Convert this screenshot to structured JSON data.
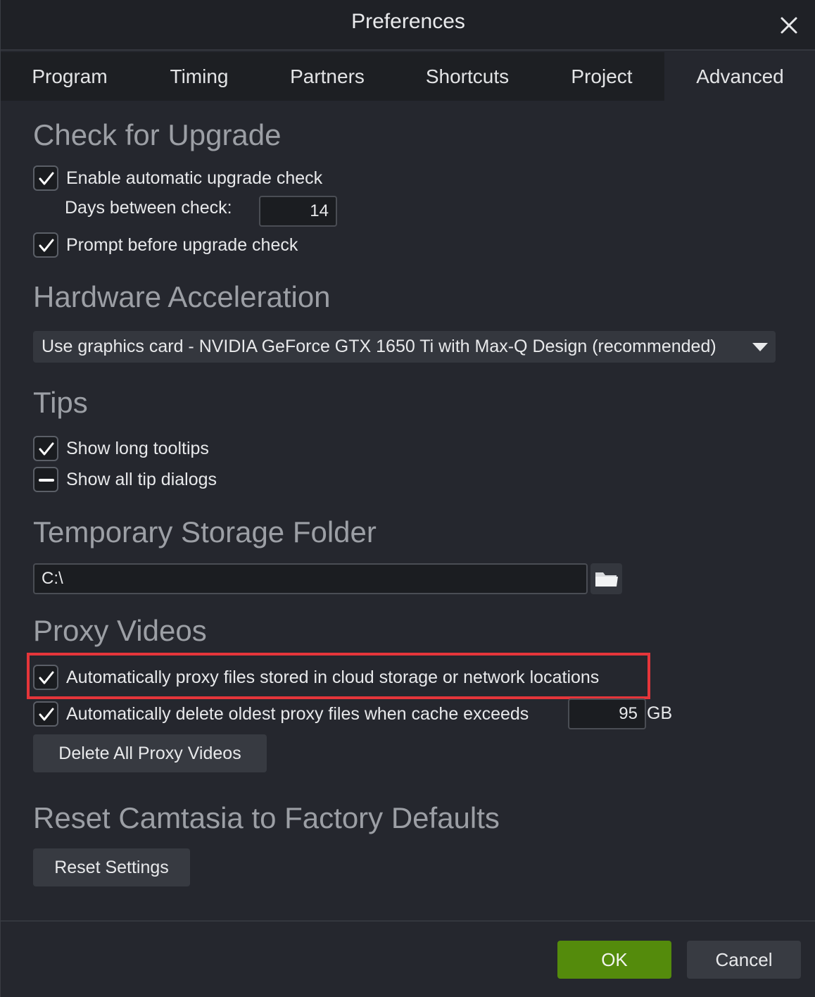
{
  "window": {
    "title": "Preferences"
  },
  "tabs": [
    {
      "label": "Program"
    },
    {
      "label": "Timing"
    },
    {
      "label": "Partners"
    },
    {
      "label": "Shortcuts"
    },
    {
      "label": "Project"
    },
    {
      "label": "Advanced",
      "active": true
    }
  ],
  "upgrade": {
    "title": "Check for Upgrade",
    "auto_check_label": "Enable automatic upgrade check",
    "auto_check": true,
    "days_label": "Days between check:",
    "days_value": "14",
    "prompt_label": "Prompt before upgrade check",
    "prompt": true
  },
  "hardware": {
    "title": "Hardware Acceleration",
    "selected": "Use graphics card - NVIDIA GeForce GTX 1650 Ti with Max-Q Design (recommended)"
  },
  "tips": {
    "title": "Tips",
    "long_tooltips_label": "Show long tooltips",
    "long_tooltips": "checked",
    "tip_dialogs_label": "Show all tip dialogs",
    "tip_dialogs": "indeterminate"
  },
  "storage": {
    "title": "Temporary Storage Folder",
    "path": "C:\\"
  },
  "proxy": {
    "title": "Proxy Videos",
    "auto_proxy_label": "Automatically proxy files stored in cloud storage or network locations",
    "auto_proxy": true,
    "auto_delete_label": "Automatically delete oldest proxy files when cache exceeds",
    "auto_delete": true,
    "cache_value": "95",
    "cache_unit": "GB",
    "delete_button": "Delete All Proxy Videos"
  },
  "reset": {
    "title": "Reset Camtasia to Factory Defaults",
    "button": "Reset Settings"
  },
  "footer": {
    "ok": "OK",
    "cancel": "Cancel"
  },
  "colors": {
    "ok_green": "#548b0c",
    "highlight_red": "#e5353a",
    "background": "#25272e"
  }
}
